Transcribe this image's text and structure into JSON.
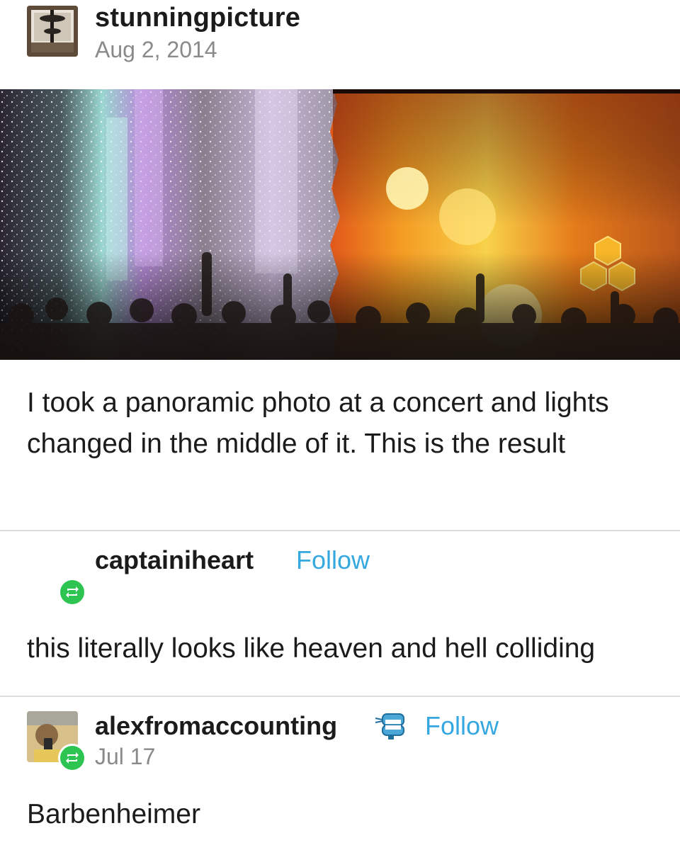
{
  "original_post": {
    "username": "stunningpicture",
    "date": "Aug 2, 2014",
    "caption": "I took a panoramic photo at a concert and lights changed in the middle of it. This is the result"
  },
  "reblog_1": {
    "username": "captainiheart",
    "follow_label": "Follow",
    "text": "this literally looks like heaven and hell colliding"
  },
  "reblog_2": {
    "username": "alexfromaccounting",
    "follow_label": "Follow",
    "date": "Jul 17",
    "text": "Barbenheimer"
  },
  "colors": {
    "follow": "#35a8e0",
    "reblog_badge": "#2ec451",
    "date_gray": "#8a8a8a"
  }
}
